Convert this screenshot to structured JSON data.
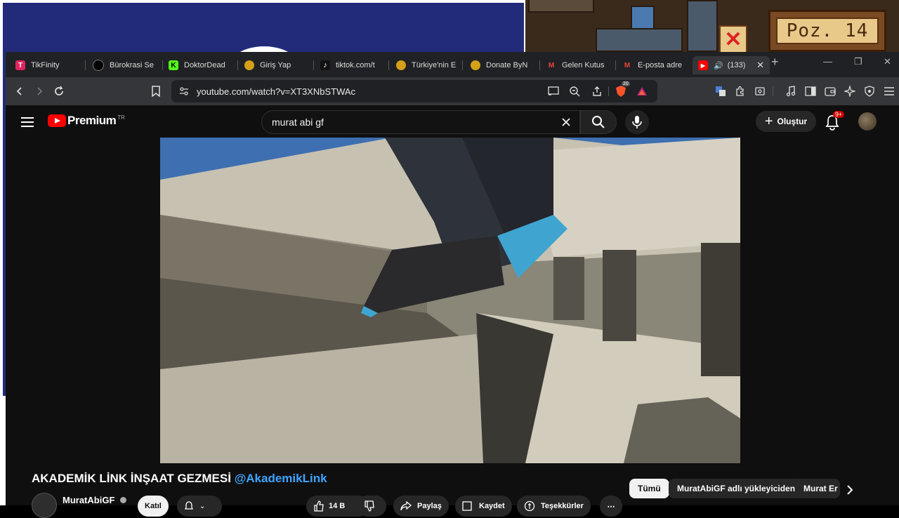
{
  "background": {
    "game_sign": "Poz. 14",
    "game_x_glyph": "✕"
  },
  "tabs": [
    {
      "label": "TikFinity",
      "icon": "tikfinity-icon",
      "color": "#e0245e",
      "glyph": "T"
    },
    {
      "label": "Bürokrasi Se",
      "icon": "bullhorn-icon",
      "color": "#000000",
      "glyph": "◉"
    },
    {
      "label": "DoktorDead",
      "icon": "kick-icon",
      "color": "#53fc18",
      "glyph": "K"
    },
    {
      "label": "Giriş Yap",
      "icon": "globe-hat-icon",
      "color": "#d4a017",
      "glyph": "◆"
    },
    {
      "label": "tiktok.com/t",
      "icon": "tiktok-icon",
      "color": "#111111",
      "glyph": "♪"
    },
    {
      "label": "Türkiye'nin E",
      "icon": "globe-hat-icon",
      "color": "#d4a017",
      "glyph": "◆"
    },
    {
      "label": "Donate ByN",
      "icon": "globe-hat-icon",
      "color": "#d4a017",
      "glyph": "◆"
    },
    {
      "label": "Gelen Kutus",
      "icon": "gmail-icon",
      "color": "#ea4335",
      "glyph": "M"
    },
    {
      "label": "E-posta adre",
      "icon": "gmail-icon",
      "color": "#ea4335",
      "glyph": "M"
    },
    {
      "label": "(133)",
      "icon": "youtube-icon",
      "color": "#ff0000",
      "glyph": "▶",
      "active": true,
      "audio": "🔊"
    }
  ],
  "tab_close": "✕",
  "new_tab": "+",
  "window_controls": {
    "minimize": "—",
    "restore": "❐",
    "close": "✕"
  },
  "address_bar": {
    "url": "youtube.com/watch?v=XT3XNbSTWAc"
  },
  "brave_badge": "20",
  "youtube": {
    "logo_text": "Premium",
    "logo_country": "TR",
    "search_query": "murat abi gf",
    "create_label": "Oluştur",
    "notif_badge": "9+",
    "video_title": "AKADEMİK LİNK İNŞAAT GEZMESİ",
    "video_handle": "@AkademikLink",
    "channel_name": "MuratAbiGF",
    "join_label": "Katıl",
    "like_count": "14 B",
    "share_label": "Paylaş",
    "save_label": "Kaydet",
    "thanks_label": "Teşekkürler",
    "more_label": "⋯",
    "chips": [
      "Tümü",
      "MuratAbiGF adlı yükleyiciden",
      "Murat Er"
    ]
  }
}
